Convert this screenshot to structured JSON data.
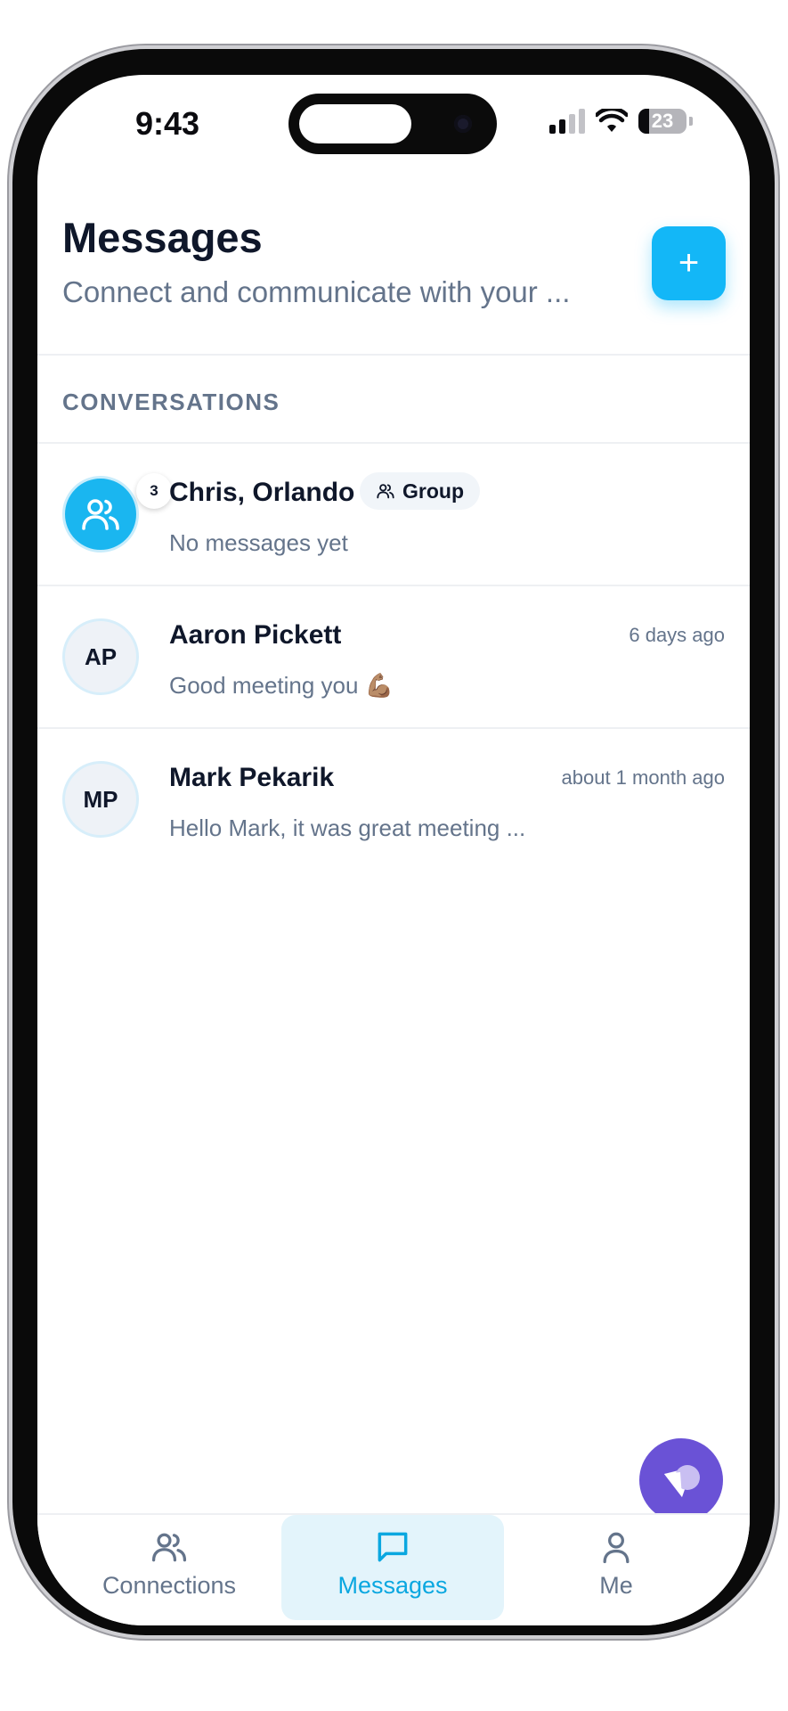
{
  "status_bar": {
    "time": "9:43",
    "battery": "23"
  },
  "header": {
    "title": "Messages",
    "subtitle": "Connect and communicate with your ..."
  },
  "new_button": {
    "icon": "plus-icon",
    "label": "+"
  },
  "section_label": "CONVERSATIONS",
  "conversations": [
    {
      "name": "Chris, Orlando",
      "chip": "Group",
      "preview": "No messages yet",
      "time": "",
      "avatar_icon": "users-icon",
      "badge": "3"
    },
    {
      "name": "Aaron Pickett",
      "initials": "AP",
      "preview": "Good meeting you 💪🏽",
      "time": "6 days ago"
    },
    {
      "name": "Mark Pekarik",
      "initials": "MP",
      "preview": "Hello Mark, it was great meeting ...",
      "time": "about 1 month ago"
    }
  ],
  "bottom_nav": [
    {
      "label": "Connections",
      "icon": "users-icon",
      "active": false
    },
    {
      "label": "Messages",
      "icon": "message-icon",
      "active": true
    },
    {
      "label": "Me",
      "icon": "person-icon",
      "active": false
    }
  ],
  "colors": {
    "accent": "#13b7f7",
    "help_button": "#6a52d6",
    "nav_active_bg": "#e3f4fb"
  }
}
